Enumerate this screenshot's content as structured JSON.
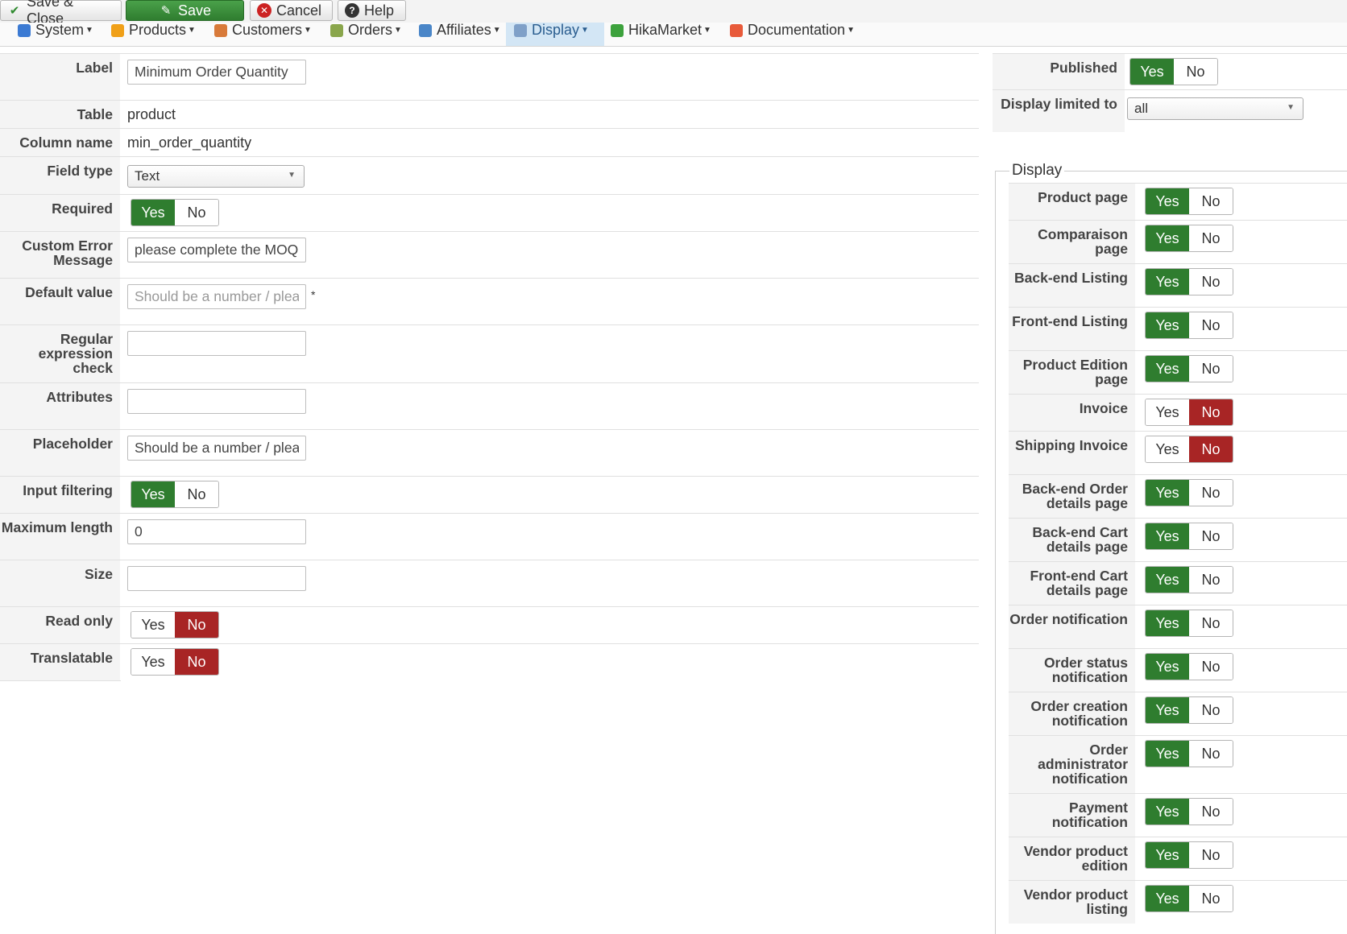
{
  "toolbar": {
    "save_close": "Save & Close",
    "save": "Save",
    "cancel": "Cancel",
    "help": "Help"
  },
  "menu": [
    {
      "label": "System",
      "icon": "tools-icon",
      "color": "#3b7ad3"
    },
    {
      "label": "Products",
      "icon": "box-icon",
      "color": "#f0a018"
    },
    {
      "label": "Customers",
      "icon": "users-icon",
      "color": "#d87a3a"
    },
    {
      "label": "Orders",
      "icon": "orders-icon",
      "color": "#8aa64c"
    },
    {
      "label": "Affiliates",
      "icon": "affiliates-icon",
      "color": "#4a86c8"
    },
    {
      "label": "Display",
      "icon": "display-icon",
      "color": "#7fa0c8",
      "active": true
    },
    {
      "label": "HikaMarket",
      "icon": "market-icon",
      "color": "#3da23d"
    },
    {
      "label": "Documentation",
      "icon": "doc-icon",
      "color": "#e85a3a"
    }
  ],
  "form": {
    "label": {
      "label": "Label",
      "value": "Minimum Order Quantity"
    },
    "table": {
      "label": "Table",
      "value": "product"
    },
    "column": {
      "label": "Column name",
      "value": "min_order_quantity"
    },
    "field_type": {
      "label": "Field type",
      "value": "Text"
    },
    "required": {
      "label": "Required",
      "value": "Yes"
    },
    "error_message": {
      "label": "Custom Error Message",
      "value": "please complete the MOQ"
    },
    "default_value": {
      "label": "Default value",
      "placeholder": "Should be a number / please",
      "star": "*"
    },
    "regex": {
      "label": "Regular expression check",
      "value": ""
    },
    "attributes": {
      "label": "Attributes",
      "value": ""
    },
    "placeholder": {
      "label": "Placeholder",
      "value": "Should be a number / please"
    },
    "input_filtering": {
      "label": "Input filtering",
      "value": "Yes"
    },
    "max_length": {
      "label": "Maximum length",
      "value": "0"
    },
    "size": {
      "label": "Size",
      "value": ""
    },
    "read_only": {
      "label": "Read only",
      "value": "No"
    },
    "translatable": {
      "label": "Translatable",
      "value": "No"
    }
  },
  "yes": "Yes",
  "no": "No",
  "right": {
    "published": {
      "label": "Published",
      "value": "Yes"
    },
    "display_limited": {
      "label": "Display limited to",
      "value": "all"
    },
    "display_legend": "Display",
    "display": [
      {
        "label": "Product page",
        "value": "Yes"
      },
      {
        "label": "Comparaison page",
        "value": "Yes"
      },
      {
        "label": "Back-end Listing",
        "value": "Yes"
      },
      {
        "label": "Front-end Listing",
        "value": "Yes"
      },
      {
        "label": "Product Edition page",
        "value": "Yes"
      },
      {
        "label": "Invoice",
        "value": "No"
      },
      {
        "label": "Shipping Invoice",
        "value": "No"
      },
      {
        "label": "Back-end Order details page",
        "value": "Yes"
      },
      {
        "label": "Back-end Cart details page",
        "value": "Yes"
      },
      {
        "label": "Front-end Cart details page",
        "value": "Yes"
      },
      {
        "label": "Order notification",
        "value": "Yes"
      },
      {
        "label": "Order status notification",
        "value": "Yes"
      },
      {
        "label": "Order creation notification",
        "value": "Yes"
      },
      {
        "label": "Order administrator notification",
        "value": "Yes"
      },
      {
        "label": "Payment notification",
        "value": "Yes"
      },
      {
        "label": "Vendor product edition",
        "value": "Yes"
      },
      {
        "label": "Vendor product listing",
        "value": "Yes"
      }
    ]
  }
}
